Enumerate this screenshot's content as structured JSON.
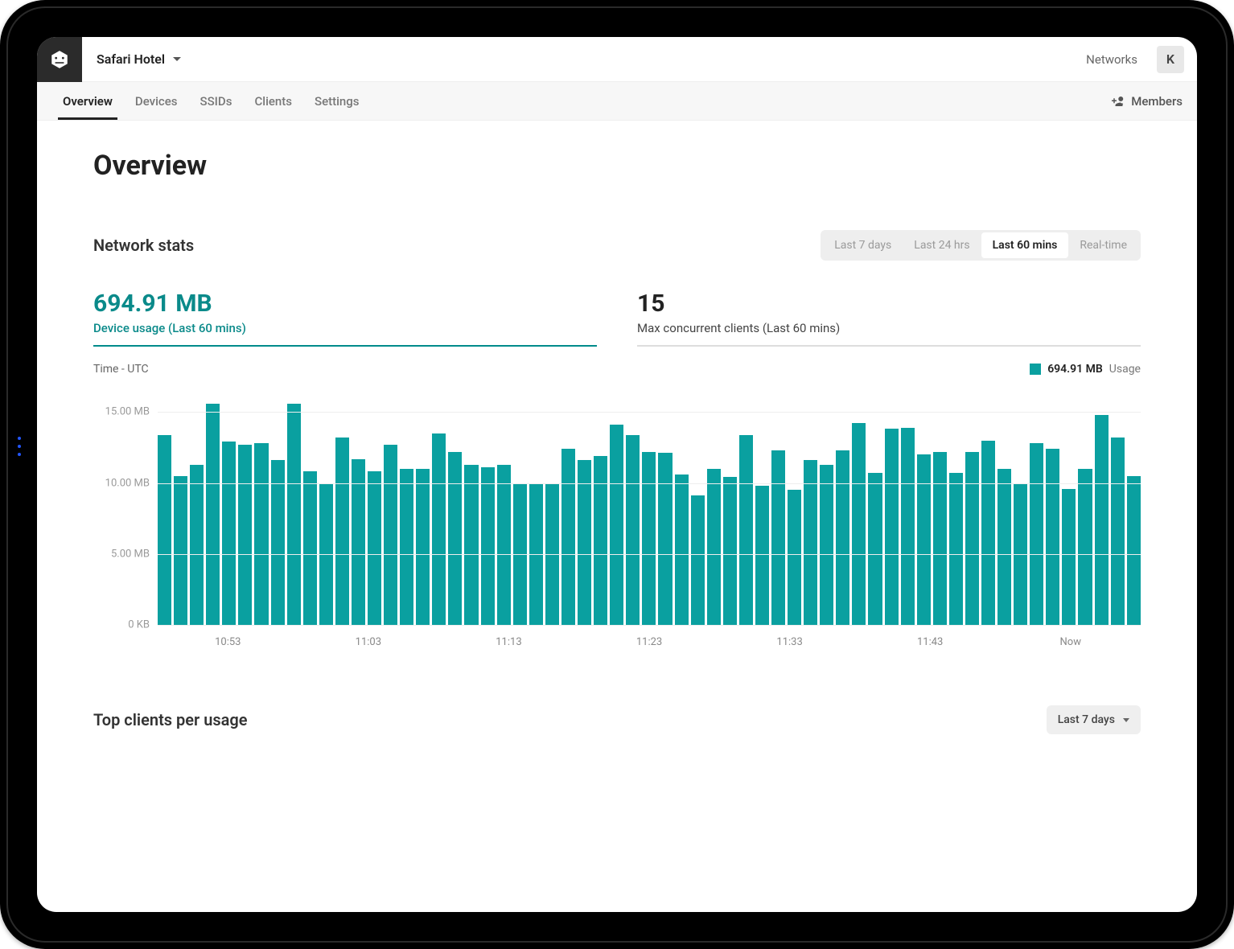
{
  "header": {
    "hotel_name": "Safari Hotel",
    "networks_label": "Networks",
    "avatar_initial": "K"
  },
  "nav": {
    "tabs": [
      "Overview",
      "Devices",
      "SSIDs",
      "Clients",
      "Settings"
    ],
    "active_index": 0,
    "members_label": "Members"
  },
  "page": {
    "title": "Overview",
    "stats_heading": "Network stats",
    "range_options": [
      "Last 7 days",
      "Last 24 hrs",
      "Last 60 mins",
      "Real-time"
    ],
    "range_active_index": 2
  },
  "kpis": [
    {
      "value": "694.91 MB",
      "label": "Device usage (Last 60 mins)",
      "selected": true
    },
    {
      "value": "15",
      "label": "Max concurrent clients (Last 60 mins)",
      "selected": false
    }
  ],
  "chart_meta": {
    "timezone_label": "Time - UTC",
    "legend_value": "694.91 MB",
    "legend_label": "Usage"
  },
  "chart_data": {
    "type": "bar",
    "title": "Device usage (Last 60 mins)",
    "xlabel": "Time - UTC",
    "ylabel": "Usage",
    "ylim": [
      0,
      17
    ],
    "y_ticks": [
      "0 KB",
      "5.00 MB",
      "10.00 MB",
      "15.00 MB"
    ],
    "x_ticks": [
      "10:53",
      "11:03",
      "11:13",
      "11:23",
      "11:33",
      "11:43",
      "Now"
    ],
    "values": [
      13.4,
      10.5,
      11.3,
      15.6,
      12.9,
      12.7,
      12.8,
      11.6,
      15.6,
      10.8,
      10.0,
      13.2,
      11.7,
      10.8,
      12.7,
      11.0,
      11.0,
      13.5,
      12.2,
      11.3,
      11.1,
      11.3,
      9.9,
      9.9,
      10.0,
      12.4,
      11.6,
      11.9,
      14.1,
      13.4,
      12.2,
      12.1,
      10.6,
      9.1,
      11.0,
      10.4,
      13.4,
      9.8,
      12.3,
      9.5,
      11.6,
      11.3,
      12.3,
      14.2,
      10.7,
      13.8,
      13.9,
      12.0,
      12.2,
      10.7,
      12.2,
      13.0,
      11.0,
      9.9,
      12.8,
      12.4,
      9.6,
      11.0,
      14.8,
      13.2,
      10.5
    ]
  },
  "top_clients": {
    "heading": "Top clients per usage",
    "range_label": "Last 7 days"
  }
}
